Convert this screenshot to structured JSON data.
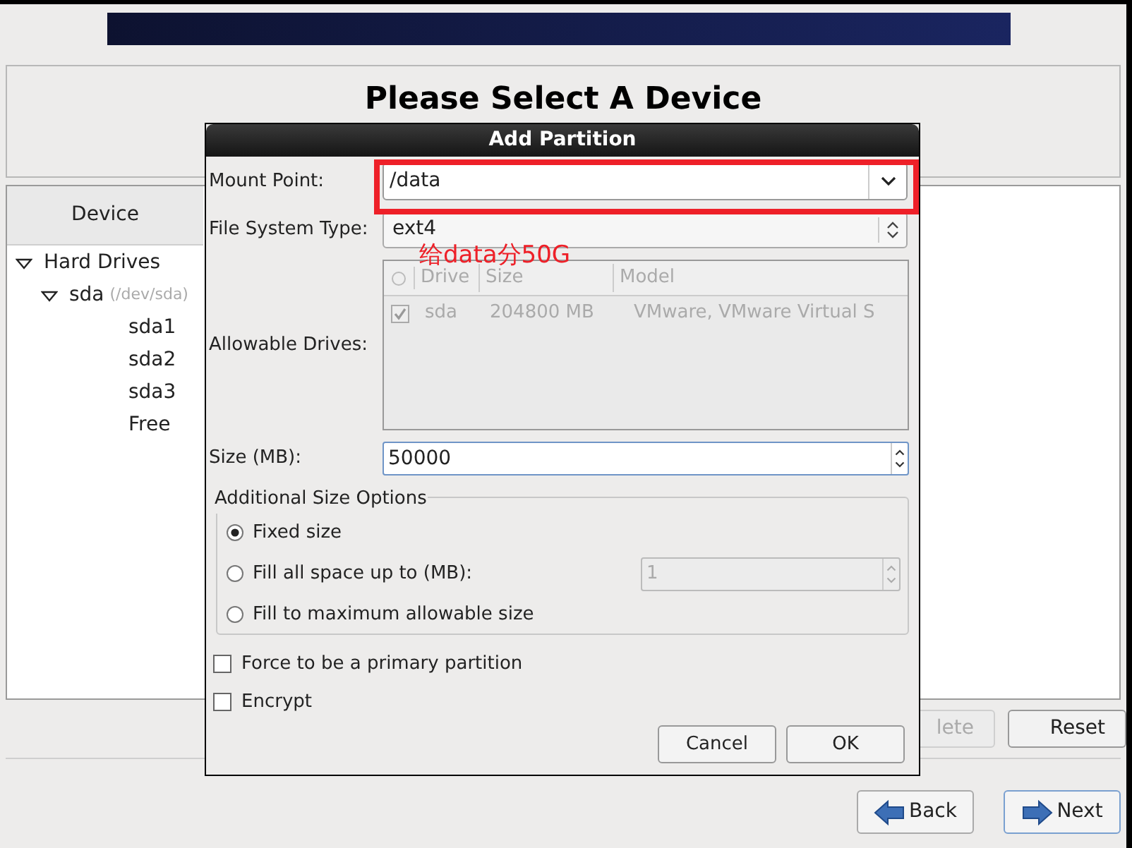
{
  "page": {
    "title": "Please Select A Device"
  },
  "device_panel": {
    "header": "Device",
    "tree": [
      {
        "label": "Hard Drives",
        "expanded": true,
        "children": [
          {
            "label": "sda",
            "note": "(/dev/sda)",
            "expanded": true,
            "children": [
              {
                "label": "sda1"
              },
              {
                "label": "sda2"
              },
              {
                "label": "sda3"
              },
              {
                "label": "Free"
              }
            ]
          }
        ]
      }
    ]
  },
  "panel_buttons": [
    {
      "label": "lete",
      "disabled": true
    },
    {
      "label": "Reset",
      "disabled": false
    }
  ],
  "nav_buttons": [
    {
      "label": "Back",
      "kind": "back"
    },
    {
      "label": "Next",
      "kind": "next"
    }
  ],
  "dialog": {
    "title": "Add Partition",
    "mount_point": {
      "label": "Mount Point:",
      "value": "/data"
    },
    "fs_type": {
      "label": "File System Type:",
      "value": "ext4"
    },
    "drives": {
      "label": "Allowable Drives:",
      "disabled": true,
      "columns": [
        "Drive",
        "Size",
        "Model"
      ],
      "rows": [
        {
          "checked": true,
          "cells": [
            "sda",
            "204800 MB",
            "VMware, VMware Virtual S"
          ]
        }
      ]
    },
    "size": {
      "label": "Size (MB):",
      "value": "50000"
    },
    "size_options": {
      "title": "Additional Size Options",
      "options": [
        {
          "label": "Fixed size",
          "selected": true
        },
        {
          "label": "Fill all space up to (MB):",
          "selected": false,
          "field": {
            "value": "1",
            "disabled": true
          }
        },
        {
          "label": "Fill to maximum allowable size",
          "selected": false
        }
      ]
    },
    "checks": [
      {
        "label": "Force to be a primary partition",
        "checked": false
      },
      {
        "label": "Encrypt",
        "checked": false
      }
    ],
    "buttons": [
      "Cancel",
      "OK"
    ]
  },
  "annotation": {
    "text": "给data分50G"
  }
}
